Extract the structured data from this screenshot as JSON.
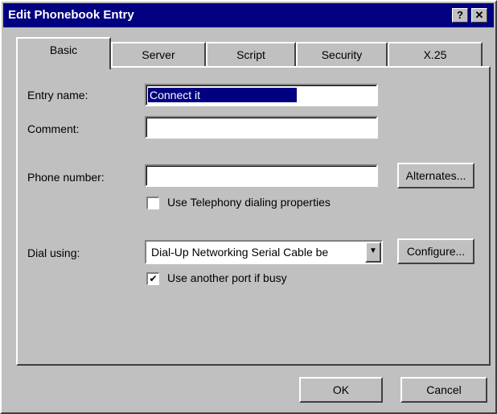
{
  "window": {
    "title": "Edit Phonebook Entry",
    "help_glyph": "?",
    "close_glyph": "✕"
  },
  "tabs": [
    {
      "label": "Basic"
    },
    {
      "label": "Server"
    },
    {
      "label": "Script"
    },
    {
      "label": "Security"
    },
    {
      "label": "X.25"
    }
  ],
  "form": {
    "entry_name_label": "Entry name:",
    "entry_name_value": "Connect it",
    "comment_label": "Comment:",
    "comment_value": "",
    "phone_number_label": "Phone number:",
    "phone_number_value": "",
    "alternates_button": "Alternates...",
    "telephony_checkbox_label": "Use Telephony dialing properties",
    "telephony_checked": false,
    "dial_using_label": "Dial using:",
    "dial_using_value": "Dial-Up Networking Serial Cable be",
    "configure_button": "Configure...",
    "another_port_label": "Use another port if busy",
    "another_port_checked": true,
    "check_glyph": "✔",
    "dropdown_glyph": "▼"
  },
  "footer": {
    "ok_label": "OK",
    "cancel_label": "Cancel"
  }
}
